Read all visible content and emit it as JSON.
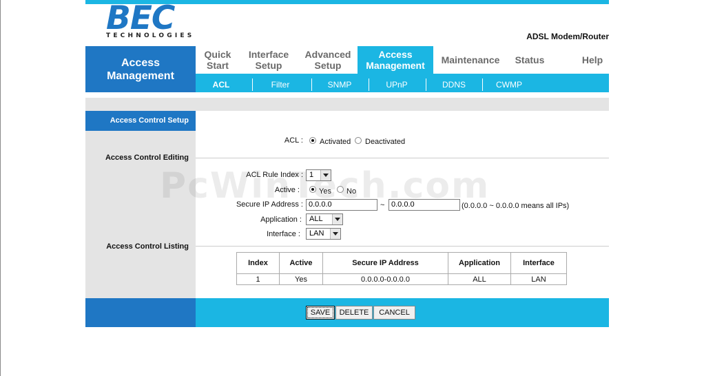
{
  "logo": {
    "brand": "BEC",
    "sub": "TECHNOLOGIES"
  },
  "product_name": "ADSL Modem/Router",
  "section_title": [
    "Access",
    "Management"
  ],
  "main_nav": [
    {
      "label1": "Quick",
      "label2": "Start"
    },
    {
      "label1": "Interface",
      "label2": "Setup"
    },
    {
      "label1": "Advanced",
      "label2": "Setup"
    },
    {
      "label1": "Access",
      "label2": "Management",
      "active": true
    },
    {
      "label1": "Maintenance",
      "label2": ""
    },
    {
      "label1": "Status",
      "label2": ""
    },
    {
      "label1": "Help",
      "label2": ""
    }
  ],
  "sub_nav": [
    "ACL",
    "Filter",
    "SNMP",
    "UPnP",
    "DDNS",
    "CWMP"
  ],
  "sub_nav_active": "ACL",
  "left": {
    "header": "Access Control Setup",
    "editing": "Access Control Editing",
    "listing": "Access Control Listing"
  },
  "acl": {
    "label": "ACL :",
    "activated": "Activated",
    "deactivated": "Deactivated",
    "selected": "Activated"
  },
  "form": {
    "rule_index_label": "ACL Rule Index :",
    "rule_index_value": "1",
    "active_label": "Active :",
    "active_yes": "Yes",
    "active_no": "No",
    "active_selected": "Yes",
    "secure_ip_label": "Secure IP Address :",
    "ip_start": "0.0.0.0",
    "ip_separator": "~",
    "ip_end": "0.0.0.0",
    "ip_hint": "(0.0.0.0 ~ 0.0.0.0 means all IPs)",
    "application_label": "Application :",
    "application_value": "ALL",
    "interface_label": "Interface :",
    "interface_value": "LAN"
  },
  "table": {
    "headers": [
      "Index",
      "Active",
      "Secure IP Address",
      "Application",
      "Interface"
    ],
    "rows": [
      [
        "1",
        "Yes",
        "0.0.0.0-0.0.0.0",
        "ALL",
        "LAN"
      ]
    ]
  },
  "buttons": {
    "save": "SAVE",
    "delete": "DELETE",
    "cancel": "CANCEL"
  },
  "watermark": "PcWinTech.com",
  "colors": {
    "primary": "#1f77c4",
    "accent": "#1bb6e3",
    "panel": "#e4e4e4"
  }
}
